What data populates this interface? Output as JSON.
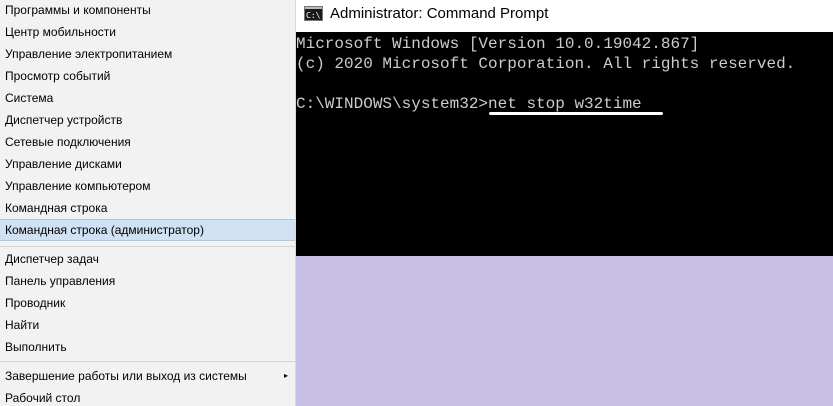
{
  "winx_menu": {
    "items": [
      {
        "label": "Программы и компоненты"
      },
      {
        "label": "Центр мобильности"
      },
      {
        "label": "Управление электропитанием"
      },
      {
        "label": "Просмотр событий"
      },
      {
        "label": "Система"
      },
      {
        "label": "Диспетчер устройств"
      },
      {
        "label": "Сетевые подключения"
      },
      {
        "label": "Управление дисками"
      },
      {
        "label": "Управление компьютером"
      },
      {
        "label": "Командная строка"
      },
      {
        "label": "Командная строка (администратор)"
      },
      {
        "label": "Диспетчер задач"
      },
      {
        "label": "Панель управления"
      },
      {
        "label": "Проводник"
      },
      {
        "label": "Найти"
      },
      {
        "label": "Выполнить"
      },
      {
        "label": "Завершение работы или выход из системы"
      },
      {
        "label": "Рабочий стол"
      }
    ],
    "submenu_arrow": "▸"
  },
  "cmd": {
    "icon_glyph": "C:\\",
    "title": "Administrator: Command Prompt",
    "lines": [
      "Microsoft Windows [Version 10.0.19042.867]",
      "(c) 2020 Microsoft Corporation. All rights reserved.",
      "",
      "C:\\WINDOWS\\system32>net stop w32time"
    ]
  },
  "colors": {
    "desktop": "#c7c0e4",
    "menu_bg": "#f2f2f2",
    "menu_highlight": "#cfe1f3",
    "console_bg": "#000000",
    "console_text": "#cccccc"
  }
}
